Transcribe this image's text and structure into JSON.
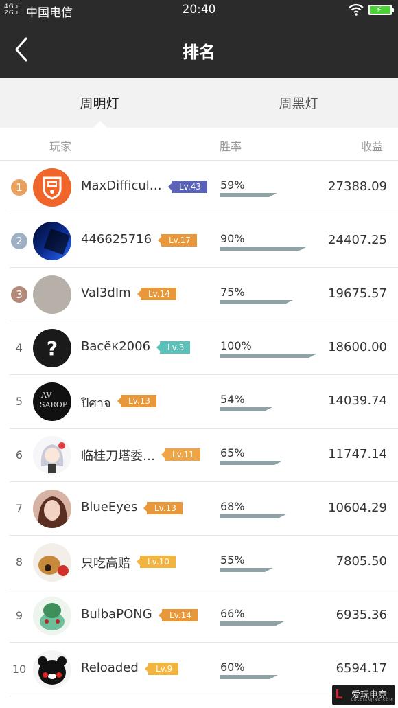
{
  "status_bar": {
    "signal_text": "4G 2G",
    "carrier": "中国电信",
    "time": "20:40"
  },
  "header": {
    "title": "排名",
    "back_icon": "chevron-left-icon"
  },
  "tabs": [
    {
      "label": "周明灯",
      "active": true
    },
    {
      "label": "周黑灯",
      "active": false
    }
  ],
  "columns": {
    "player": "玩家",
    "win_rate": "胜率",
    "profit": "收益"
  },
  "colors": {
    "header_bg": "#2b2b2b",
    "bar": "#8fa3a6",
    "medal_1": "#e8a15f",
    "medal_2": "#9fb0c4",
    "medal_3": "#b3897a"
  },
  "rows": [
    {
      "rank": "1",
      "name": "MaxDifficul…",
      "level": "Lv.43",
      "level_color": "#5a63b8",
      "win_rate_text": "59%",
      "win_rate": 0.59,
      "profit": "27388.09",
      "avatar": "orange-logo-avatar"
    },
    {
      "rank": "2",
      "name": "446625716",
      "level": "Lv.17",
      "level_color": "#e8973a",
      "win_rate_text": "90%",
      "win_rate": 0.9,
      "profit": "24407.25",
      "avatar": "blue-dark-avatar"
    },
    {
      "rank": "3",
      "name": "Val3dIm",
      "level": "Lv.14",
      "level_color": "#e8973a",
      "win_rate_text": "75%",
      "win_rate": 0.75,
      "profit": "19675.57",
      "avatar": "gray-avatar"
    },
    {
      "rank": "4",
      "name": "Васёк2006",
      "level": "Lv.3",
      "level_color": "#5bc2bb",
      "win_rate_text": "100%",
      "win_rate": 1.0,
      "profit": "18600.00",
      "avatar": "question-mark-avatar"
    },
    {
      "rank": "5",
      "name": "ปิศาจ",
      "level": "Lv.13",
      "level_color": "#e8973a",
      "win_rate_text": "54%",
      "win_rate": 0.54,
      "profit": "14039.74",
      "avatar": "dark-text-avatar"
    },
    {
      "rank": "6",
      "name": "临桂刀塔委…",
      "level": "Lv.11",
      "level_color": "#efa445",
      "win_rate_text": "65%",
      "win_rate": 0.65,
      "profit": "11747.14",
      "avatar": "anime-girl-avatar"
    },
    {
      "rank": "7",
      "name": "BlueEyes",
      "level": "Lv.13",
      "level_color": "#e8973a",
      "win_rate_text": "68%",
      "win_rate": 0.68,
      "profit": "10604.29",
      "avatar": "woman-photo-avatar"
    },
    {
      "rank": "8",
      "name": "只吃高赔",
      "level": "Lv.10",
      "level_color": "#f2b440",
      "win_rate_text": "55%",
      "win_rate": 0.55,
      "profit": "7805.50",
      "avatar": "dog-photo-avatar"
    },
    {
      "rank": "9",
      "name": "BulbaPONG",
      "level": "Lv.14",
      "level_color": "#e8973a",
      "win_rate_text": "66%",
      "win_rate": 0.66,
      "profit": "6935.36",
      "avatar": "bulbasaur-avatar"
    },
    {
      "rank": "10",
      "name": "Reloaded",
      "level": "Lv.9",
      "level_color": "#f2b440",
      "win_rate_text": "60%",
      "win_rate": 0.6,
      "profit": "6594.17",
      "avatar": "kumamon-avatar"
    }
  ],
  "watermark": {
    "mark": "L",
    "text": "爱玩电竞",
    "subtext": "LOLDIANJING.COM"
  }
}
